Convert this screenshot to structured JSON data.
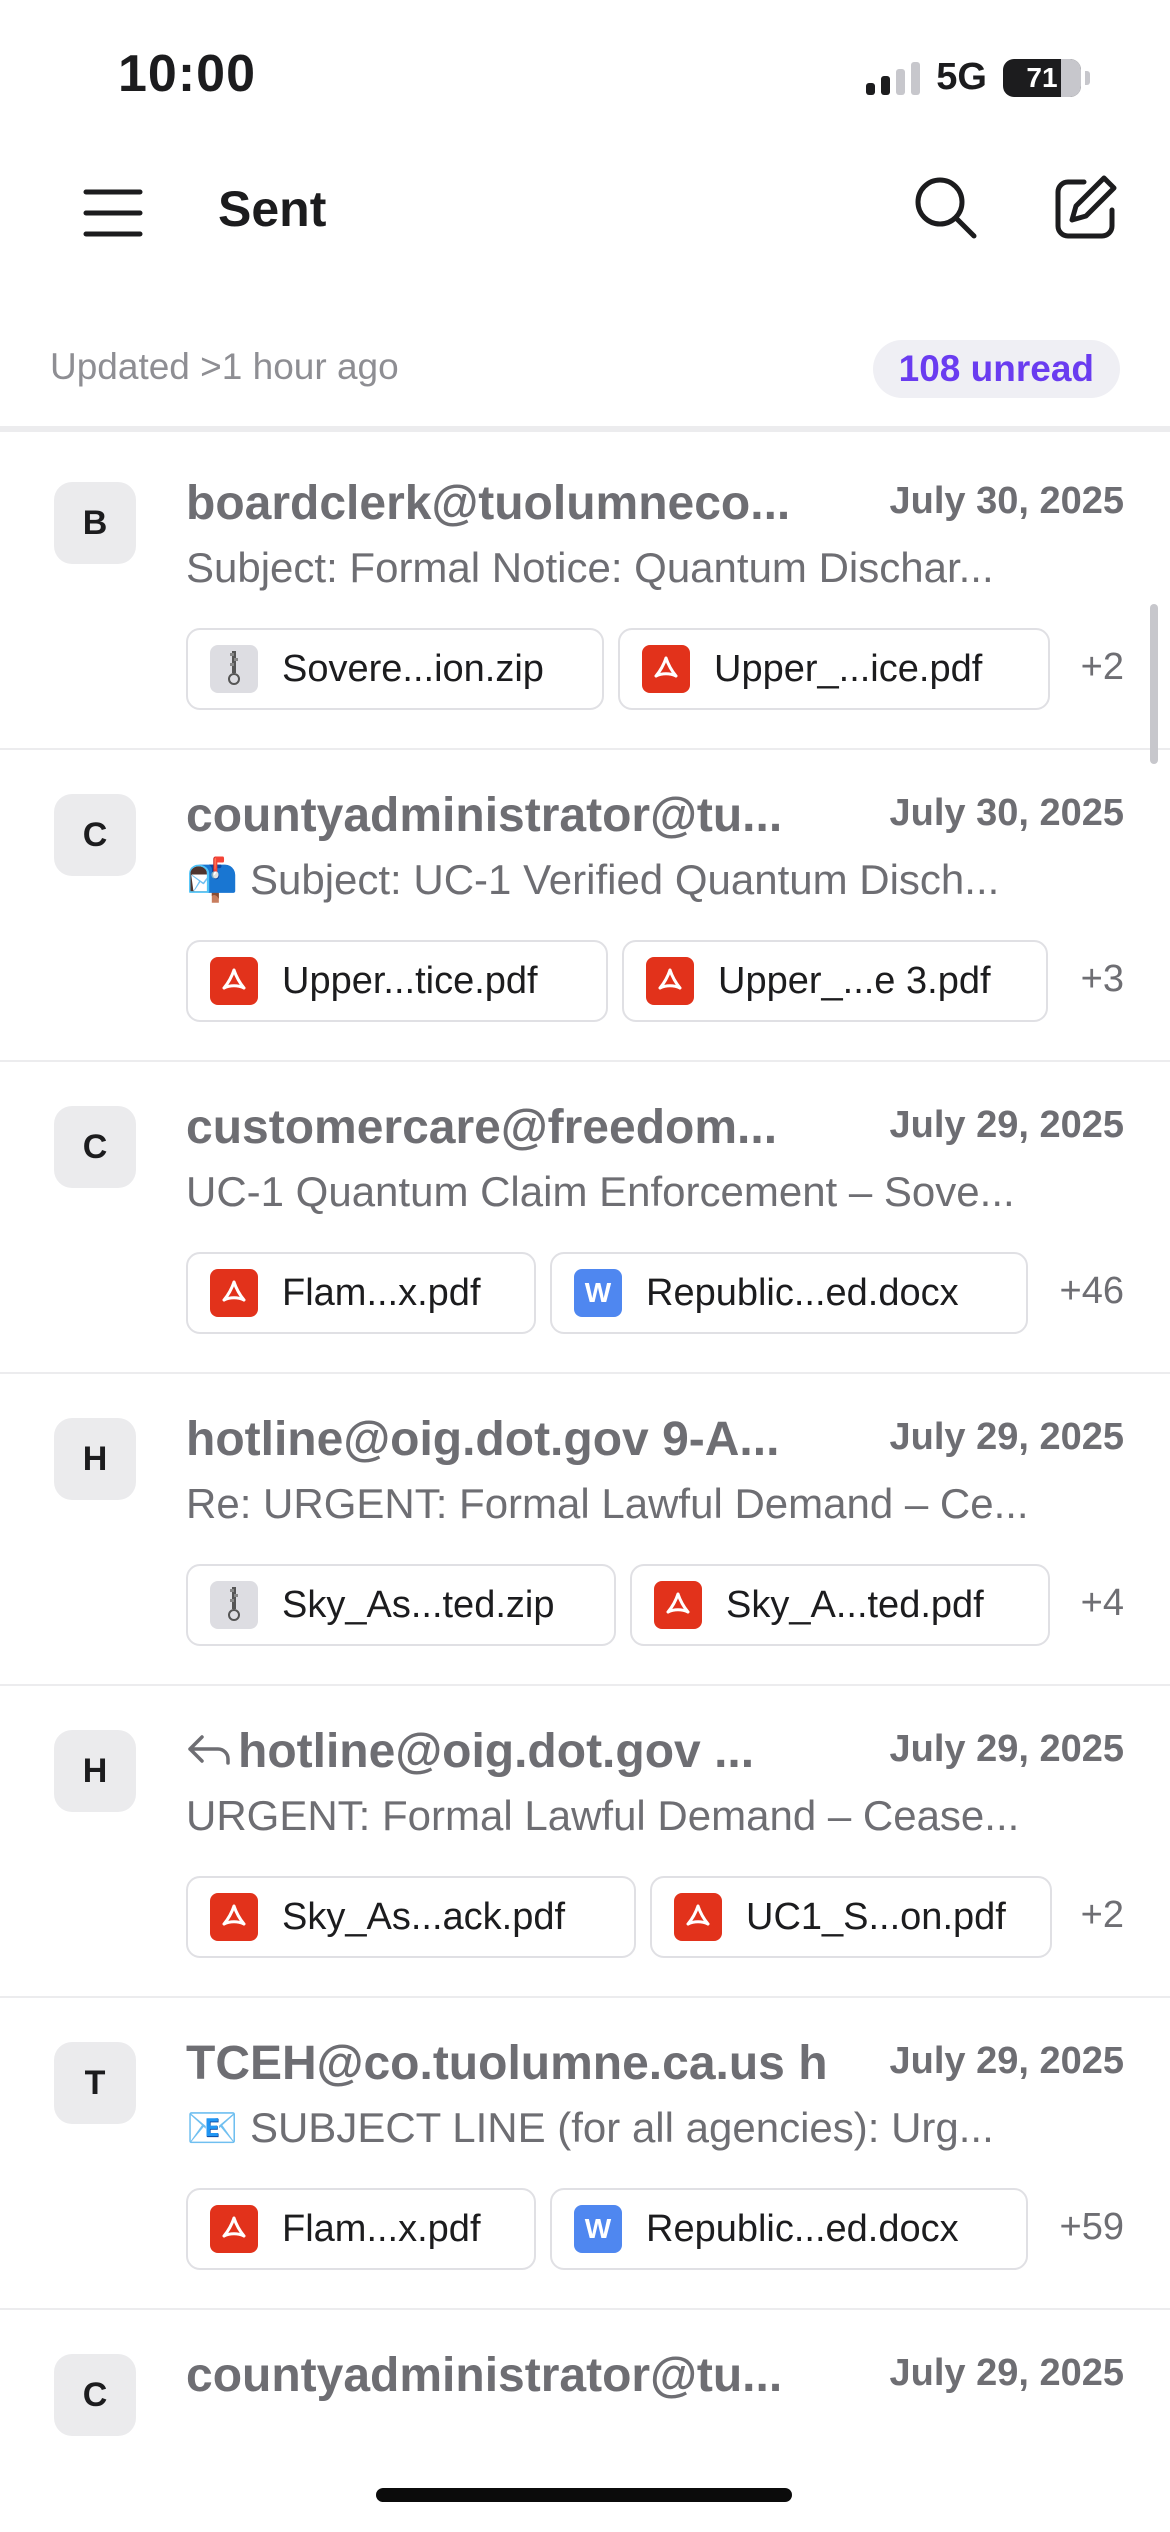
{
  "status_bar": {
    "time": "10:00",
    "network": "5G",
    "battery": "71"
  },
  "header": {
    "title": "Sent"
  },
  "sync": {
    "updated": "Updated >1 hour ago",
    "unread": "108 unread"
  },
  "messages": [
    {
      "initial": "B",
      "sender": "boardclerk@tuolumneco...",
      "date": "July 30, 2025",
      "subject": "Subject: Formal Notice: Quantum Dischar...",
      "attachments": [
        {
          "name": "Sovere...ion.zip",
          "type": "zip"
        },
        {
          "name": "Upper_...ice.pdf",
          "type": "pdf"
        }
      ],
      "more": "+2"
    },
    {
      "initial": "C",
      "sender": "countyadministrator@tu...",
      "date": "July 30, 2025",
      "subject": "📬 Subject: UC-1 Verified Quantum Disch...",
      "attachments": [
        {
          "name": "Upper...tice.pdf",
          "type": "pdf"
        },
        {
          "name": "Upper_...e 3.pdf",
          "type": "pdf"
        }
      ],
      "more": "+3"
    },
    {
      "initial": "C",
      "sender": "customercare@freedom...",
      "date": "July 29, 2025",
      "subject": "UC-1 Quantum Claim Enforcement – Sove...",
      "attachments": [
        {
          "name": "Flam...x.pdf",
          "type": "pdf"
        },
        {
          "name": "Republic...ed.docx",
          "type": "docx"
        }
      ],
      "more": "+46"
    },
    {
      "initial": "H",
      "sender": "hotline@oig.dot.gov 9-A...",
      "date": "July 29, 2025",
      "subject": "Re: URGENT: Formal Lawful Demand – Ce...",
      "attachments": [
        {
          "name": "Sky_As...ted.zip",
          "type": "zip"
        },
        {
          "name": "Sky_A...ted.pdf",
          "type": "pdf"
        }
      ],
      "more": "+4"
    },
    {
      "initial": "H",
      "sender": "hotline@oig.dot.gov ...",
      "reply_icon": "reply-arrow-icon",
      "date": "July 29, 2025",
      "subject": "URGENT: Formal Lawful Demand – Cease...",
      "attachments": [
        {
          "name": "Sky_As...ack.pdf",
          "type": "pdf"
        },
        {
          "name": "UC1_S...on.pdf",
          "type": "pdf"
        }
      ],
      "more": "+2"
    },
    {
      "initial": "T",
      "sender": "TCEH@co.tuolumne.ca.us h",
      "date": "July 29, 2025",
      "subject": "📧 SUBJECT LINE (for all agencies):  Urg...",
      "attachments": [
        {
          "name": "Flam...x.pdf",
          "type": "pdf"
        },
        {
          "name": "Republic...ed.docx",
          "type": "docx"
        }
      ],
      "more": "+59"
    },
    {
      "initial": "C",
      "sender": "countyadministrator@tu...",
      "date": "July 29, 2025",
      "subject": "",
      "attachments": [],
      "more": ""
    }
  ],
  "icons": {
    "menu": "hamburger-menu-icon",
    "search": "search-icon",
    "compose": "compose-icon",
    "pdf": "pdf-file-icon",
    "docx": "word-file-icon",
    "zip": "zip-file-icon"
  }
}
